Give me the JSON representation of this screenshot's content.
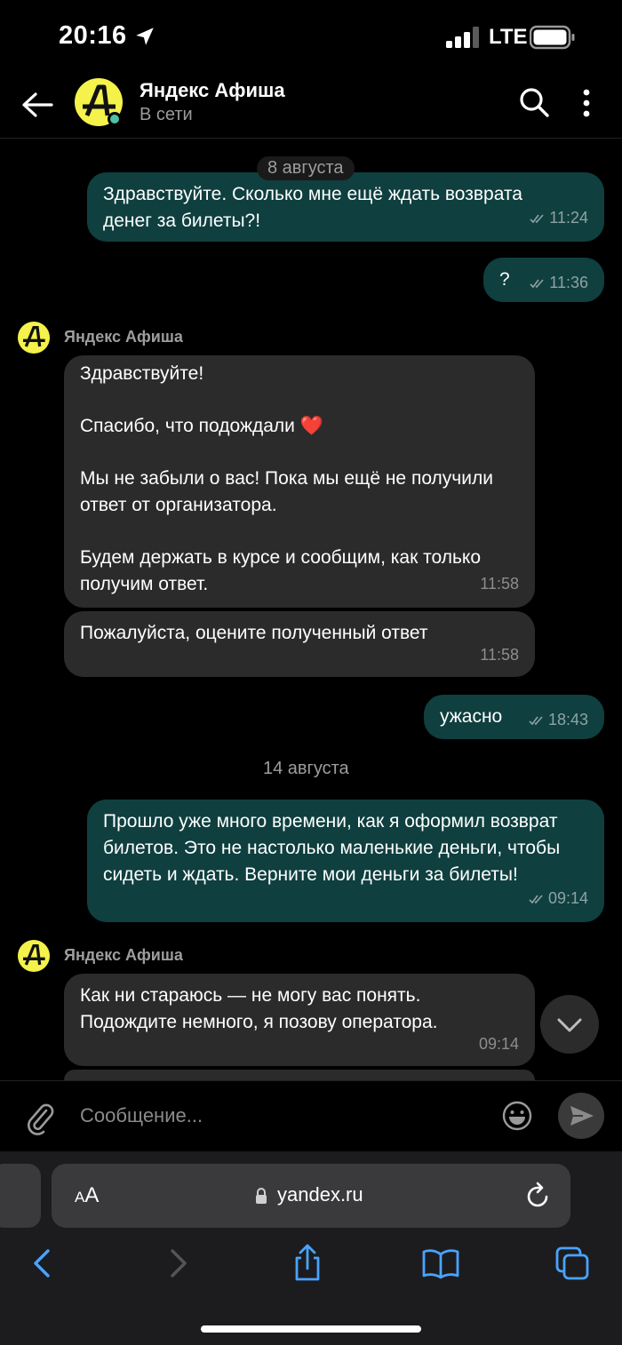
{
  "status_bar": {
    "time": "20:16",
    "network": "LTE"
  },
  "header": {
    "name": "Яндекс Афиша",
    "status": "В сети"
  },
  "avatar_letter": "А",
  "messages": [
    {
      "date": "8 августа"
    },
    {
      "text": "Здравствуйте. Сколько мне ещё ждать возврата денег за билеты?!",
      "time": "11:24"
    },
    {
      "text": "?",
      "time": "11:36"
    },
    {
      "sender": "Яндекс Афиша"
    },
    {
      "p1": "Здравствуйте!",
      "p2": "Спасибо, что подождали ❤️",
      "p3": "Мы не забыли о вас! Пока мы ещё не получили ответ от организатора.",
      "p4": "Будем держать в курсе и сообщим, как только получим ответ.",
      "time": "11:58"
    },
    {
      "text": "Пожалуйста, оцените полученный ответ",
      "time": "11:58"
    },
    {
      "text": "ужасно",
      "time": "18:43"
    },
    {
      "date": "14 августа"
    },
    {
      "text": "Прошло уже много времени, как я оформил возврат билетов. Это не настолько маленькие деньги, чтобы сидеть и ждать. Верните мои деньги за билеты!",
      "time": "09:14"
    },
    {
      "sender": "Яндекс Афиша"
    },
    {
      "text": "Как ни стараюсь — не могу вас понять. Подождите немного, я позову оператора.",
      "time": "09:14"
    }
  ],
  "composer": {
    "placeholder": "Сообщение..."
  },
  "browser": {
    "text_size_label": "A",
    "text_size_small": "A",
    "url": "yandex.ru"
  },
  "colors": {
    "outgoing": "#0f3f3f",
    "incoming": "#2b2b2b",
    "avatar": "#f4f24b",
    "accent": "#4aa3ff"
  }
}
